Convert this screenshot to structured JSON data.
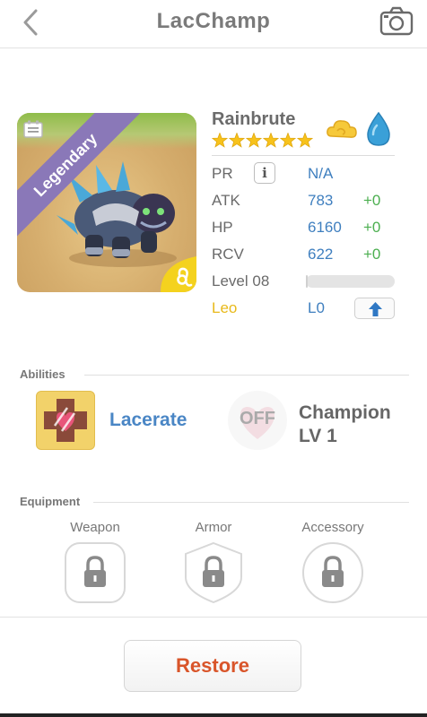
{
  "header": {
    "title": "LacChamp",
    "back_icon": "chevron-left-icon",
    "camera_icon": "camera-icon"
  },
  "portrait": {
    "rarity": "Legendary",
    "rarity_color": "#8a78b8",
    "sign_icon": "leo-icon",
    "card_icon": "card-icon"
  },
  "monster": {
    "name": "Rainbrute",
    "stars": 6,
    "elements": [
      "cloud-icon",
      "water-drop-icon"
    ]
  },
  "stats": {
    "pr": {
      "label": "PR",
      "value": "N/A"
    },
    "atk": {
      "label": "ATK",
      "value": "783",
      "bonus": "+0"
    },
    "hp": {
      "label": "HP",
      "value": "6160",
      "bonus": "+0"
    },
    "rcv": {
      "label": "RCV",
      "value": "622",
      "bonus": "+0"
    },
    "level": {
      "label": "Level 08",
      "progress": 0.02
    },
    "sign": {
      "label": "Leo",
      "value": "L0"
    }
  },
  "abilities": {
    "title": "Abilities",
    "active": {
      "name": "Lacerate"
    },
    "passive": {
      "state": "OFF",
      "line1": "Champion",
      "line2": "LV 1"
    }
  },
  "equipment": {
    "title": "Equipment",
    "slots": [
      {
        "label": "Weapon"
      },
      {
        "label": "Armor"
      },
      {
        "label": "Accessory"
      }
    ]
  },
  "footer": {
    "restore_label": "Restore"
  },
  "colors": {
    "accent_blue": "#3f7fbf",
    "bonus_green": "#4caf50",
    "restore_red": "#d9552a",
    "leo_gold": "#e8b91a"
  }
}
